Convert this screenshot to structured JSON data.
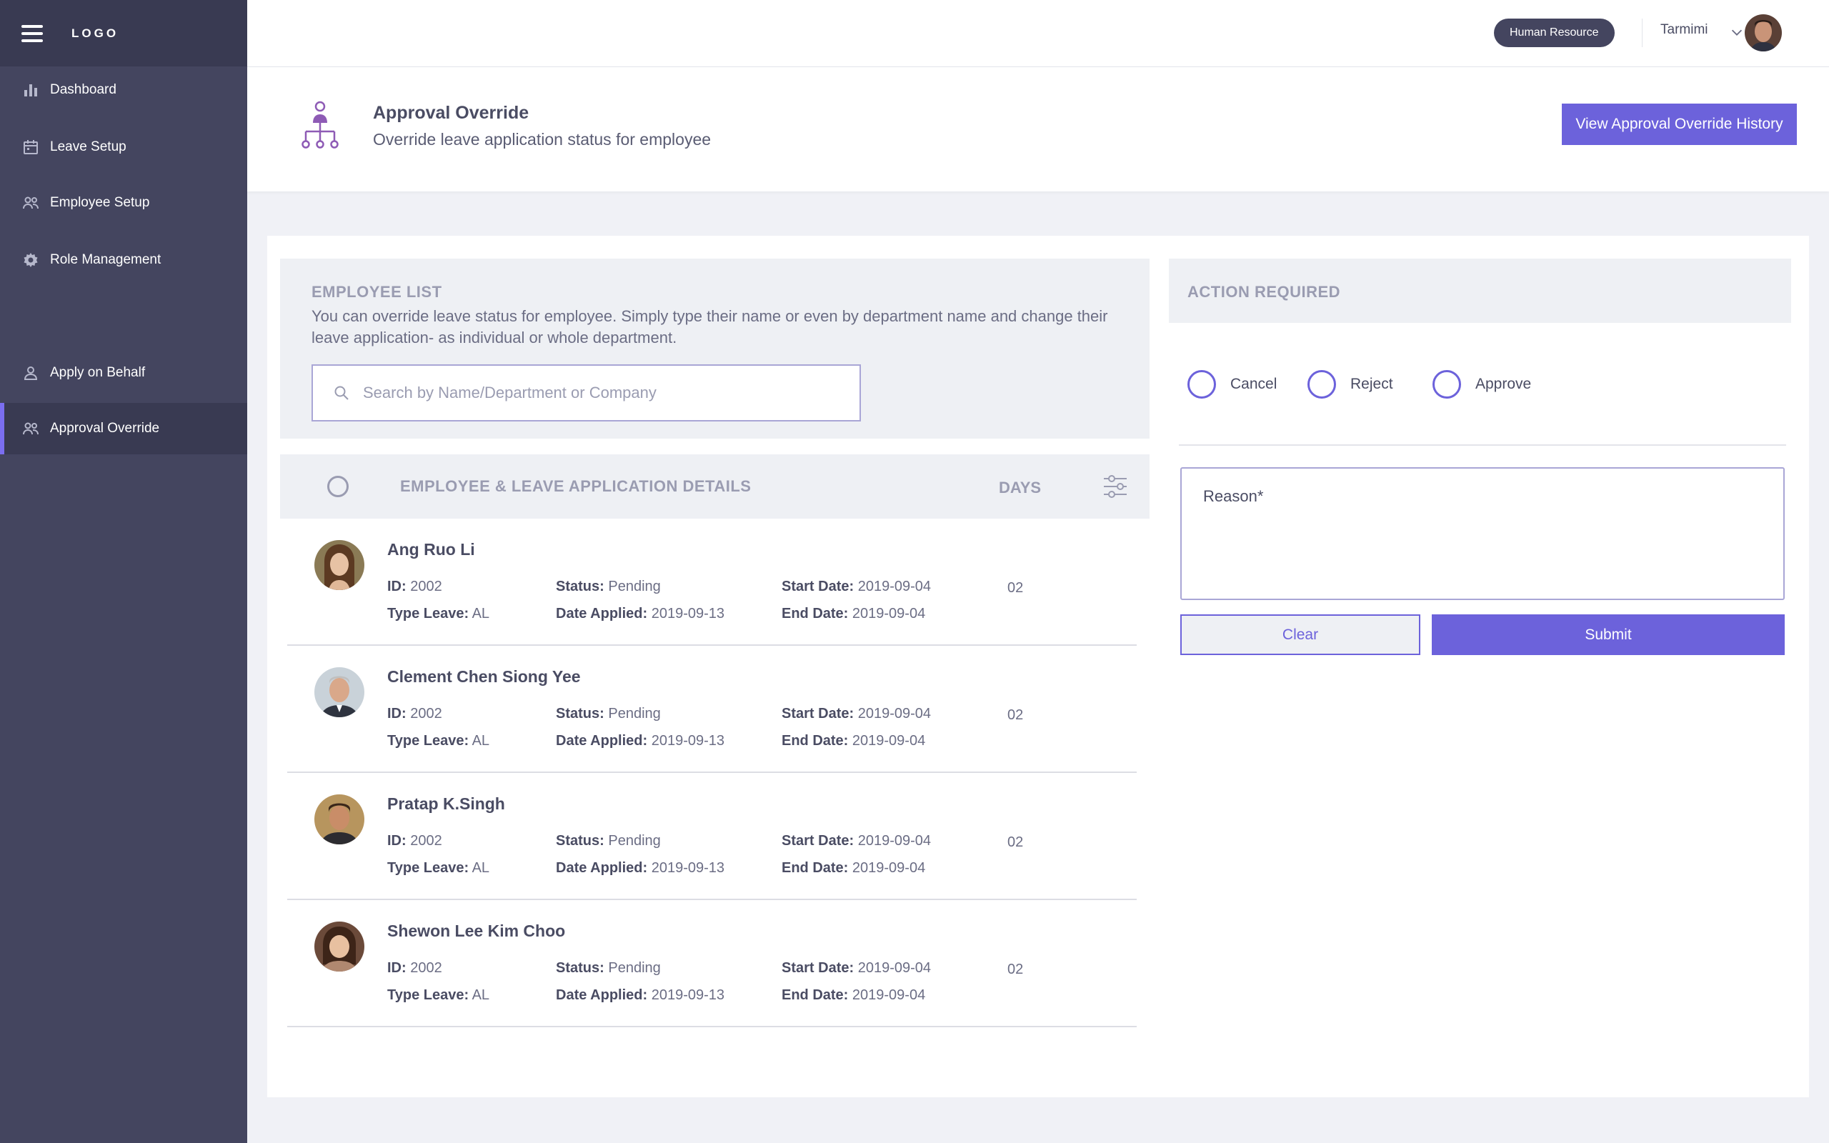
{
  "sidebar": {
    "logo": "LOGO",
    "menu_icon": "hamburger-icon",
    "items": [
      {
        "label": "Dashboard",
        "icon": "bar-chart-icon"
      },
      {
        "label": "Leave Setup",
        "icon": "calendar-icon"
      },
      {
        "label": "Employee Setup",
        "icon": "users-icon"
      },
      {
        "label": "Role Management",
        "icon": "gear-icon"
      },
      {
        "label": "Apply on Behalf",
        "icon": "user-icon"
      },
      {
        "label": "Approval Override",
        "icon": "users-icon",
        "active": true
      }
    ]
  },
  "topbar": {
    "role_badge": "Human Resource",
    "user_name": "Tarmimi"
  },
  "header": {
    "title": "Approval Override",
    "subtitle": "Override leave application status for employee",
    "history_button": "View Approval Override History"
  },
  "employee_list": {
    "heading": "EMPLOYEE LIST",
    "description": "You can override leave status for employee. Simply type their name or even by department name and change their leave application- as individual or whole department.",
    "search_placeholder": "Search by Name/Department or Company"
  },
  "table": {
    "details_header": "EMPLOYEE  & LEAVE APPLICATION DETAILS",
    "days_header": "DAYS",
    "labels": {
      "id": "ID:",
      "status": "Status:",
      "start_date": "Start Date:",
      "type_leave": "Type Leave:",
      "date_applied": "Date Applied:",
      "end_date": "End Date:"
    },
    "rows": [
      {
        "name": "Ang Ruo Li",
        "id": "2002",
        "status": "Pending",
        "start_date": "2019-09-04",
        "type_leave": "AL",
        "date_applied": "2019-09-13",
        "end_date": "2019-09-04",
        "days": "02"
      },
      {
        "name": "Clement Chen Siong Yee",
        "id": "2002",
        "status": "Pending",
        "start_date": "2019-09-04",
        "type_leave": "AL",
        "date_applied": "2019-09-13",
        "end_date": "2019-09-04",
        "days": "02"
      },
      {
        "name": "Pratap K.Singh",
        "id": "2002",
        "status": "Pending",
        "start_date": "2019-09-04",
        "type_leave": "AL",
        "date_applied": "2019-09-13",
        "end_date": "2019-09-04",
        "days": "02"
      },
      {
        "name": "Shewon Lee Kim Choo",
        "id": "2002",
        "status": "Pending",
        "start_date": "2019-09-04",
        "type_leave": "AL",
        "date_applied": "2019-09-13",
        "end_date": "2019-09-04",
        "days": "02"
      }
    ]
  },
  "action": {
    "heading": "ACTION REQUIRED",
    "options": [
      "Cancel",
      "Reject",
      "Approve"
    ],
    "reason_placeholder": "Reason*",
    "clear_button": "Clear",
    "submit_button": "Submit"
  },
  "colors": {
    "sidebar_bg": "#44455f",
    "sidebar_dark": "#393a52",
    "accent": "#6c62db",
    "page_bg": "#f0f1f6",
    "panel_bg": "#eef0f4"
  }
}
